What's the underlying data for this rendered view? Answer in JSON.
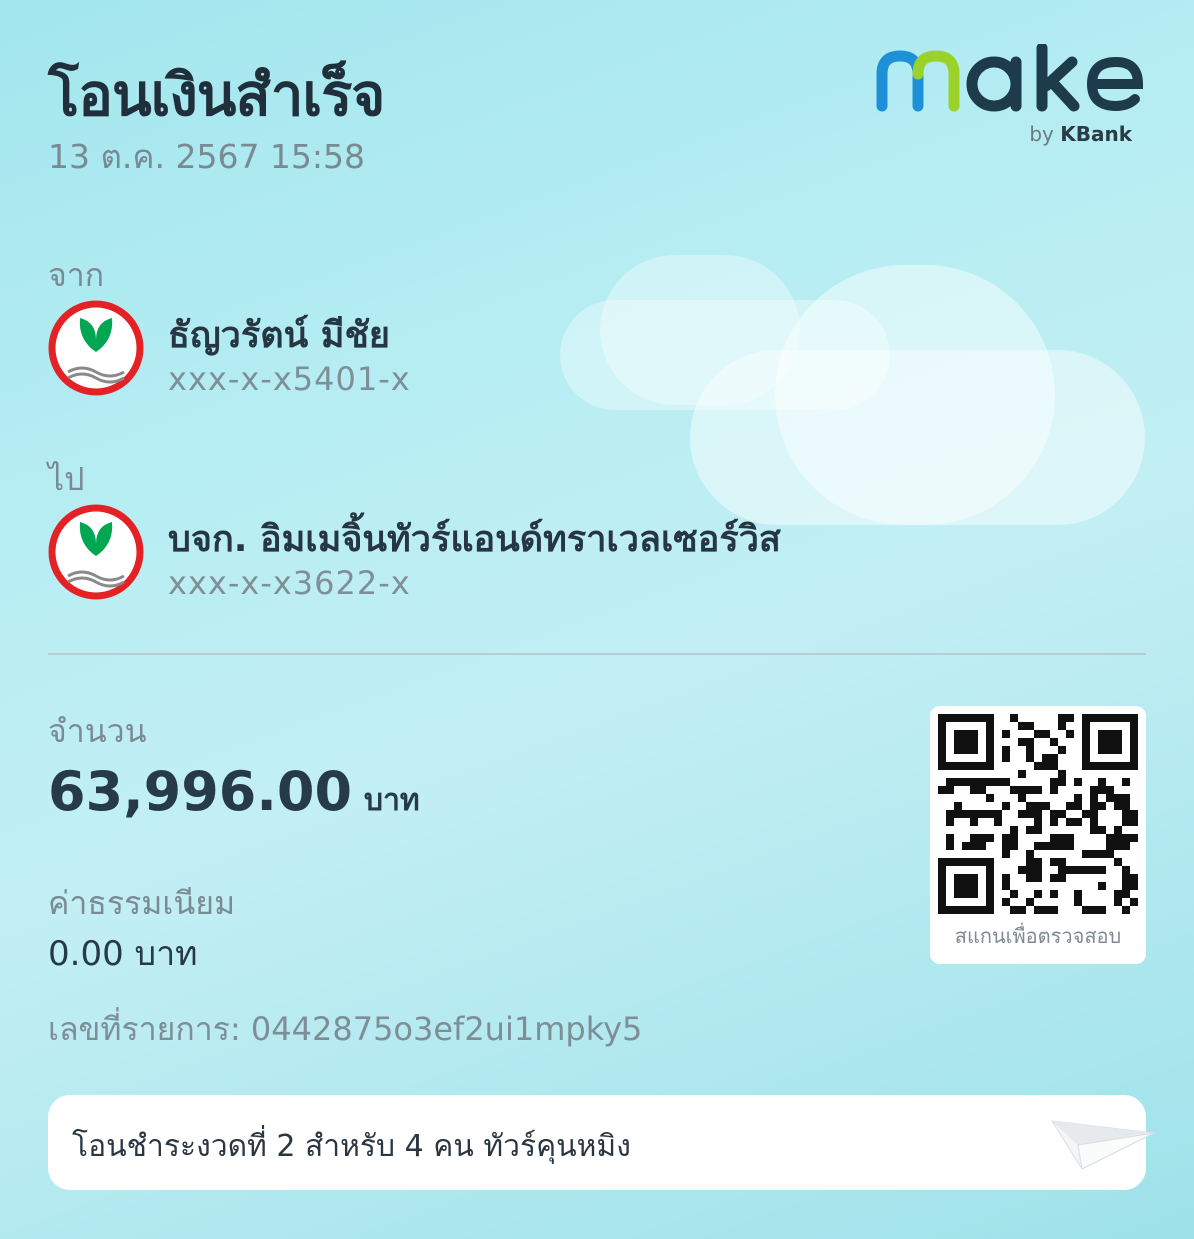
{
  "header": {
    "title": "โอนเงินสำเร็จ",
    "datetime": "13 ต.ค. 2567 15:58"
  },
  "brand": {
    "logo_text": "make",
    "by_text": "by",
    "bank_text": "KBank",
    "colors": {
      "primary": "#1d3b4a",
      "accent_blue": "#1e90d8",
      "accent_green": "#9bd22a",
      "kbank_red": "#e42125",
      "kbank_green": "#00a651"
    }
  },
  "transfer": {
    "from_label": "จาก",
    "from": {
      "name": "ธัญวรัตน์ มีชัย",
      "account": "xxx-x-x5401-x",
      "icon": "kbank-logo-icon"
    },
    "to_label": "ไป",
    "to": {
      "name": "บจก. อิมเมจิ้นทัวร์แอนด์ทราเวลเซอร์วิส",
      "account": "xxx-x-x3622-x",
      "icon": "kbank-logo-icon"
    }
  },
  "amount": {
    "label": "จำนวน",
    "value": "63,996.00",
    "unit": "บาท"
  },
  "fee": {
    "label": "ค่าธรรมเนียม",
    "value": "0.00 บาท"
  },
  "reference": {
    "text": "เลขที่รายการ: 0442875o3ef2ui1mpky5"
  },
  "qr": {
    "caption": "สแกนเพื่อตรวจสอบ"
  },
  "memo": {
    "text": "โอนชำระงวดที่ 2 สำหรับ 4 คน ทัวร์คุนหมิง"
  }
}
